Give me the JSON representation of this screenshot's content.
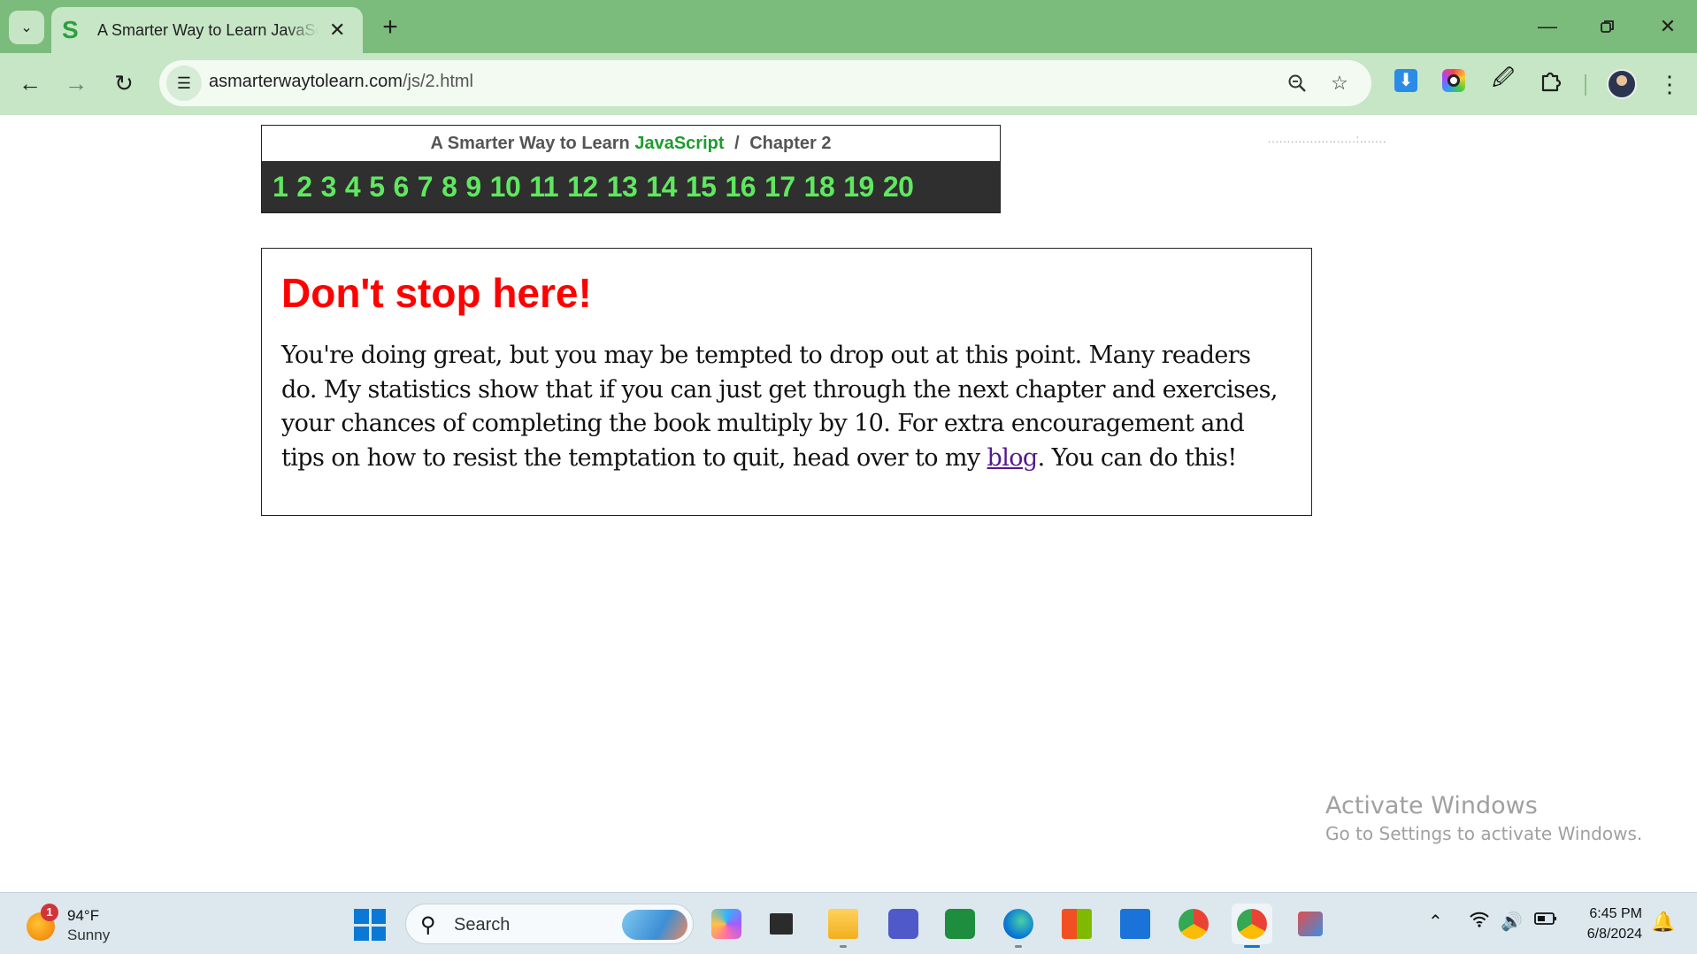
{
  "browser": {
    "tab": {
      "favicon_letter": "S",
      "title": "A Smarter Way to Learn JavaScript"
    },
    "url": {
      "domain": "asmarterwaytolearn.com",
      "path": "/js/2.html"
    }
  },
  "page": {
    "header": {
      "title_prefix": "A Smarter Way to Learn",
      "title_highlight": "JavaScript",
      "separator": "/",
      "chapter_label": "Chapter 2",
      "chapters": [
        "1",
        "2",
        "3",
        "4",
        "5",
        "6",
        "7",
        "8",
        "9",
        "10",
        "11",
        "12",
        "13",
        "14",
        "15",
        "16",
        "17",
        "18",
        "19",
        "20"
      ]
    },
    "promo": {
      "heading": "Don't stop here!",
      "body_before_link": "You're doing great, but you may be tempted to drop out at this point. Many readers do. My statistics show that if you can just get through the next chapter and exercises, your chances of completing the book multiply by 10. For extra encouragement and tips on how to resist the temptation to quit, head over to my ",
      "link_text": "blog",
      "body_after_link": ". You can do this!"
    },
    "watermark": {
      "line1": "Activate Windows",
      "line2": "Go to Settings to activate Windows."
    }
  },
  "taskbar": {
    "weather": {
      "temp": "94°F",
      "condition": "Sunny",
      "badge": "1"
    },
    "search_placeholder": "Search",
    "clock": {
      "time": "6:45 PM",
      "date": "6/8/2024"
    }
  },
  "colors": {
    "tab_strip": "#7bbb7b",
    "toolbar": "#c6e6c6",
    "chapter_link": "#5fe85f",
    "javascript_green": "#1e9c2e",
    "heading_red": "#ff0000",
    "visited_link": "#551a8b"
  }
}
